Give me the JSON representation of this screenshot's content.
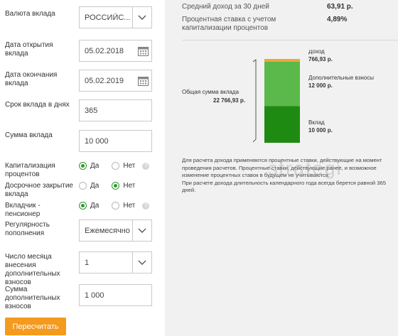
{
  "form": {
    "currency": {
      "label": "Валюта вклада",
      "value": "РОССИЙС..."
    },
    "open_date": {
      "label": "Дата открытия вклада",
      "value": "05.02.2018"
    },
    "close_date": {
      "label": "Дата окончания вклада",
      "value": "05.02.2019"
    },
    "term_days": {
      "label": "Срок вклада в днях",
      "value": "365"
    },
    "amount": {
      "label": "Сумма вклада",
      "value": "10 000"
    },
    "capitalization": {
      "label": "Капитализация процентов",
      "yes": "Да",
      "no": "Нет",
      "selected": "yes"
    },
    "early_close": {
      "label": "Досрочное закрытие вклада",
      "yes": "Да",
      "no": "Нет",
      "selected": "no"
    },
    "pensioner": {
      "label": "Вкладчик - пенсионер",
      "yes": "Да",
      "no": "Нет",
      "selected": "yes"
    },
    "replenishment": {
      "label": "Регулярность пополнения",
      "value": "Ежемесячно"
    },
    "month_number": {
      "label": "Число месяца внесения дополнительных взносов",
      "value": "1"
    },
    "extra_amount": {
      "label": "Сумма дополнительных взносов",
      "value": "1 000"
    },
    "recalc_button": "Пересчитать"
  },
  "summary": {
    "avg_income_label": "Средний доход за 30 дней",
    "avg_income_value": "63,91 р.",
    "rate_label": "Процентная ставка с учетом капитализации процентов",
    "rate_value": "4,89%"
  },
  "chart_data": {
    "type": "bar",
    "total_label": "Общая сумма вклада",
    "total_value": "22 766,93 р.",
    "segments": [
      {
        "name": "Вклад",
        "value_text": "10 000 р.",
        "value": 10000,
        "color": "#1f8a12"
      },
      {
        "name": "Дополнительные взносы",
        "value_text": "12 000 р.",
        "value": 12000,
        "color": "#5ab94a"
      },
      {
        "name": "Доход",
        "value_text": "766,93 р.",
        "value": 766.93,
        "color": "#f0a53a"
      }
    ]
  },
  "note": {
    "p1": "Для расчета дохода применяются процентные ставки, действующие на момент проведения расчетов. Процентные ставки, действующие ранее, и возможное изменение процентных ставок в будущем не учитываются.",
    "p2": "При расчете дохода длительность календарного года всегда берется равной 365 дней."
  },
  "watermark": "strategi",
  "icons": {
    "chevron": "chevron-down-icon",
    "calendar": "calendar-icon",
    "help": "help-icon"
  }
}
